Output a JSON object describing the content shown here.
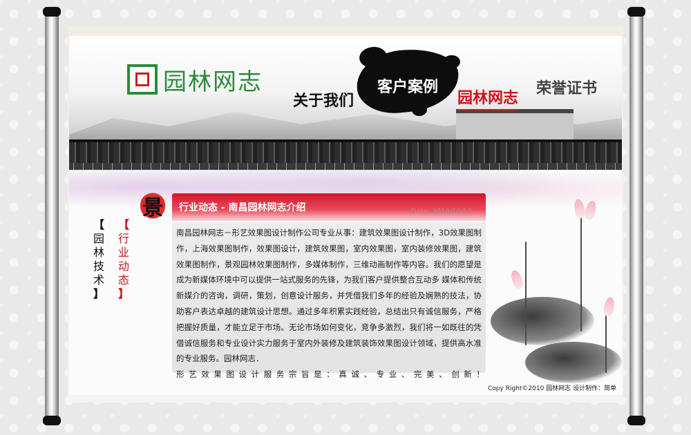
{
  "logo": {
    "text": "园林网志"
  },
  "nav": {
    "about": "关于我们",
    "cases": "客户案例",
    "journal": "园林网志",
    "honor": "荣誉证书"
  },
  "seal": {
    "char": "景"
  },
  "side_tabs": {
    "news": {
      "open": "【",
      "label": "行业动态",
      "close": "】"
    },
    "tech": {
      "open": "【",
      "label": "园林技术",
      "close": "】"
    }
  },
  "article": {
    "title": "行业动态 - 南昌园林网志介绍",
    "date": "Date: 2010/10/10",
    "body": "南昌园林网志－形艺效果图设计制作公司专业从事：建筑效果图设计制作，3D效果图制作，上海效果图制作，效果图设计，建筑效果图，室内效果图，室内装修效果图，建筑效果图制作，景观园林效果图制作，多媒体制作，三维动画制作等内容。我们的愿望是成为新媒体环境中可以提供一站式服务的先锋，为我们客户提供整合互动多 媒体和传统新媒介的咨询，调研，策划，创意设计服务，并凭借我们多年的经验及娴熟的技法，协助客户表达卓越的建筑设计思想。通过多年积累实践经验，总结出只有诚信服务，严格把握好质量，才能立足于市场。无论市场如何变化，竞争多激烈，我们将一如既往的凭借诚信服务和专业设计实力服务于室内外装修及建筑装饰效果图设计领域，提供高水准的专业服务。园林网志．",
    "slogan": "形艺效果图设计服务宗旨是：真诚、专业、完美、创新！"
  },
  "footer": {
    "copyright": "Copy Right©2010 园林网志 设计制作：简单"
  }
}
